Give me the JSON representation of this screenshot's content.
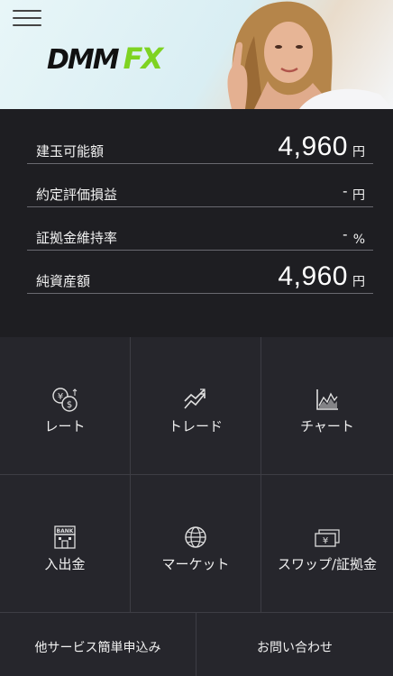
{
  "header": {
    "logo_dmm": "DMM",
    "logo_fx": "FX"
  },
  "summary": [
    {
      "label": "建玉可能額",
      "value": "4,960",
      "unit": "円"
    },
    {
      "label": "約定評価損益",
      "value": "-",
      "unit": "円"
    },
    {
      "label": "証拠金維持率",
      "value": "-",
      "unit": "%"
    },
    {
      "label": "純資産額",
      "value": "4,960",
      "unit": "円"
    }
  ],
  "menu": [
    {
      "label": "レート",
      "icon": "rate-icon"
    },
    {
      "label": "トレード",
      "icon": "trade-icon"
    },
    {
      "label": "チャート",
      "icon": "chart-icon"
    },
    {
      "label": "入出金",
      "icon": "bank-icon"
    },
    {
      "label": "マーケット",
      "icon": "globe-icon"
    },
    {
      "label": "スワップ/証拠金",
      "icon": "yen-bill-icon"
    }
  ],
  "bottom": {
    "services": "他サービス簡単申込み",
    "contact": "お問い合わせ"
  }
}
